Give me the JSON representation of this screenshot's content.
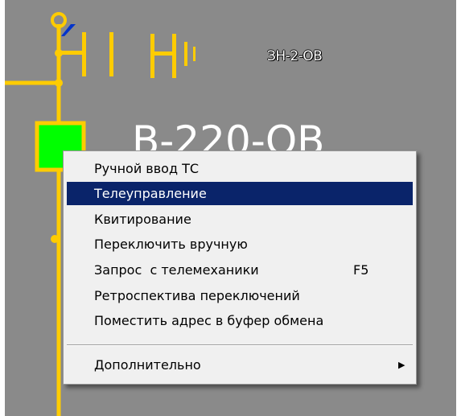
{
  "diagram": {
    "label_small": "ЗН-2-ОВ",
    "label_big": "В-220-ОВ",
    "colors": {
      "background": "#8a8a8a",
      "line": "#ffcc00",
      "breaker_on": "#00ff00"
    }
  },
  "context_menu": {
    "items": [
      {
        "label": "Ручной ввод ТС",
        "shortcut": "",
        "selected": false
      },
      {
        "label": "Телеуправление",
        "shortcut": "",
        "selected": true
      },
      {
        "label": "Квитирование",
        "shortcut": "",
        "selected": false
      },
      {
        "label": "Переключить вручную",
        "shortcut": "",
        "selected": false
      },
      {
        "label": "Запрос  с телемеханики",
        "shortcut": "F5",
        "selected": false
      },
      {
        "label": "Ретроспектива переключений",
        "shortcut": "",
        "selected": false
      },
      {
        "label": "Поместить адрес в буфер обмена",
        "shortcut": "",
        "selected": false
      }
    ],
    "submenu_item": {
      "label": "Дополнительно",
      "icon": "submenu-arrow-icon"
    },
    "colors": {
      "highlight": "#0a246a",
      "background": "#f0f0f0"
    }
  }
}
